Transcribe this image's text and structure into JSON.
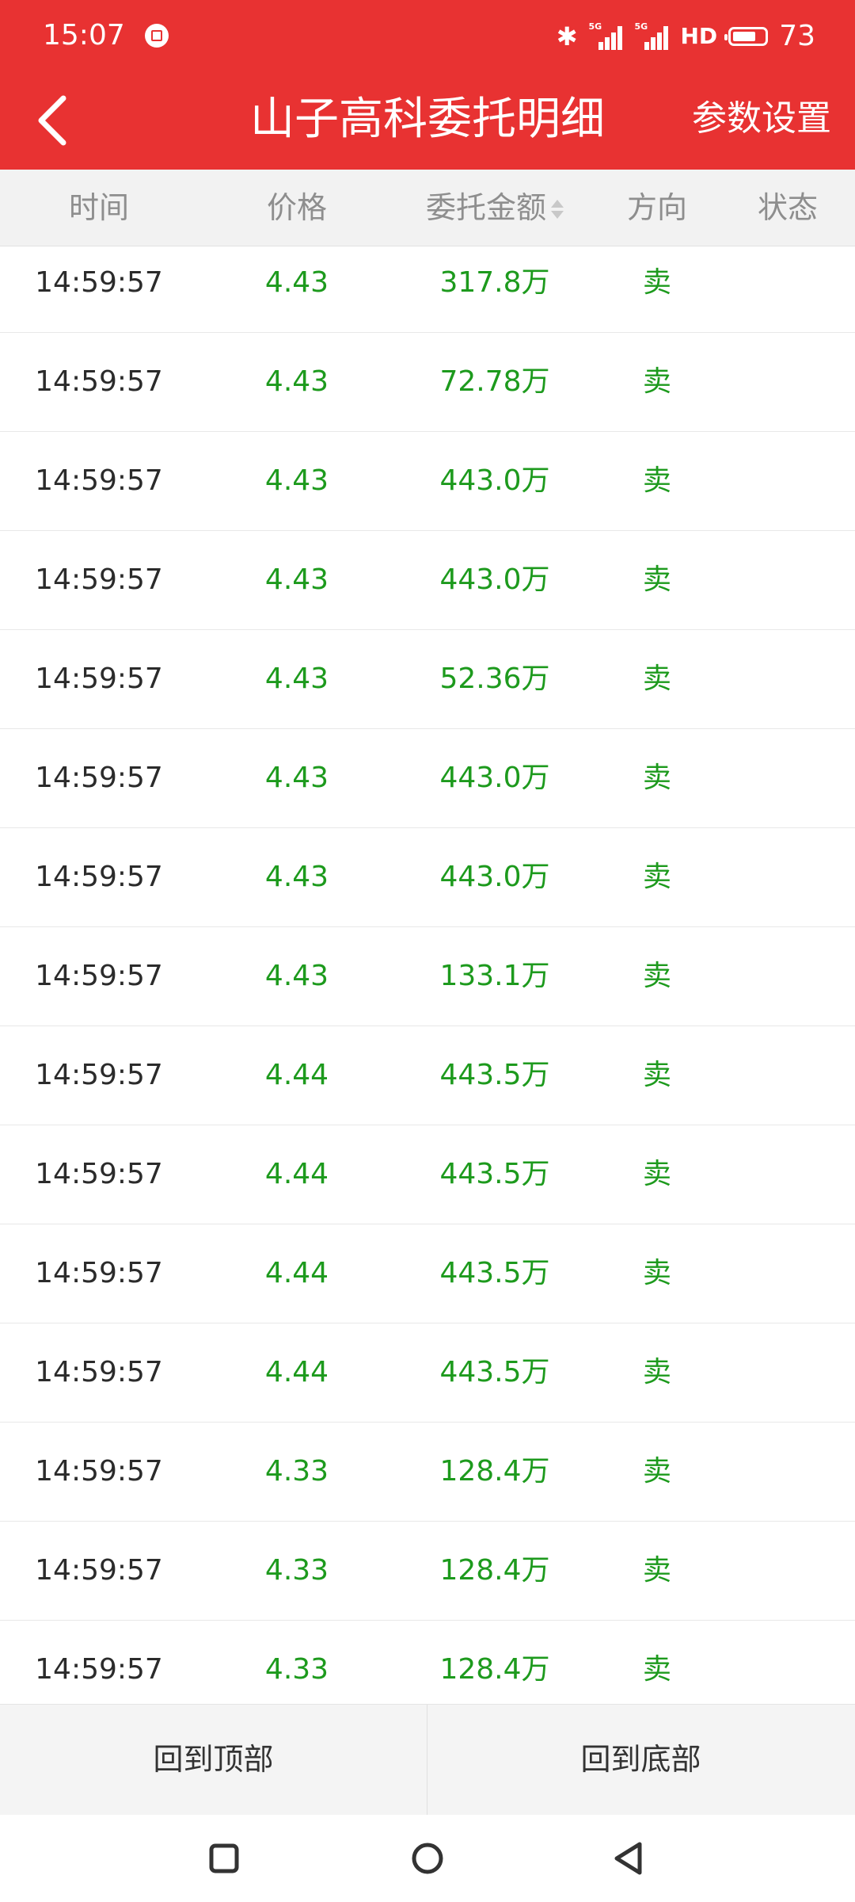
{
  "status_bar": {
    "time": "15:07",
    "signal_1_label": "5G",
    "signal_2_label": "5G",
    "hd_label": "HD",
    "battery_level": "73",
    "battery_fraction": 0.73,
    "icons": [
      "app-notification-icon",
      "bluetooth-icon",
      "signal-icon",
      "signal-icon",
      "battery-icon"
    ]
  },
  "header": {
    "title": "山子高科委托明细",
    "settings_label": "参数设置",
    "background_color": "#e83232"
  },
  "table": {
    "columns": [
      "时间",
      "价格",
      "委托金额",
      "方向",
      "状态"
    ],
    "sortable_column": "委托金额",
    "value_color": "#1d9a1d",
    "rows": [
      {
        "time": "14:59:57",
        "price": "4.43",
        "amount": "317.8万",
        "direction": "卖",
        "status": ""
      },
      {
        "time": "14:59:57",
        "price": "4.43",
        "amount": "72.78万",
        "direction": "卖",
        "status": ""
      },
      {
        "time": "14:59:57",
        "price": "4.43",
        "amount": "443.0万",
        "direction": "卖",
        "status": ""
      },
      {
        "time": "14:59:57",
        "price": "4.43",
        "amount": "443.0万",
        "direction": "卖",
        "status": ""
      },
      {
        "time": "14:59:57",
        "price": "4.43",
        "amount": "52.36万",
        "direction": "卖",
        "status": ""
      },
      {
        "time": "14:59:57",
        "price": "4.43",
        "amount": "443.0万",
        "direction": "卖",
        "status": ""
      },
      {
        "time": "14:59:57",
        "price": "4.43",
        "amount": "443.0万",
        "direction": "卖",
        "status": ""
      },
      {
        "time": "14:59:57",
        "price": "4.43",
        "amount": "133.1万",
        "direction": "卖",
        "status": ""
      },
      {
        "time": "14:59:57",
        "price": "4.44",
        "amount": "443.5万",
        "direction": "卖",
        "status": ""
      },
      {
        "time": "14:59:57",
        "price": "4.44",
        "amount": "443.5万",
        "direction": "卖",
        "status": ""
      },
      {
        "time": "14:59:57",
        "price": "4.44",
        "amount": "443.5万",
        "direction": "卖",
        "status": ""
      },
      {
        "time": "14:59:57",
        "price": "4.44",
        "amount": "443.5万",
        "direction": "卖",
        "status": ""
      },
      {
        "time": "14:59:57",
        "price": "4.33",
        "amount": "128.4万",
        "direction": "卖",
        "status": ""
      },
      {
        "time": "14:59:57",
        "price": "4.33",
        "amount": "128.4万",
        "direction": "卖",
        "status": ""
      },
      {
        "time": "14:59:57",
        "price": "4.33",
        "amount": "128.4万",
        "direction": "卖",
        "status": ""
      }
    ]
  },
  "bottom_buttons": {
    "to_top": "回到顶部",
    "to_bottom": "回到底部"
  },
  "nav_bar": {
    "icons": [
      "recent-apps-icon",
      "home-icon",
      "back-icon"
    ]
  }
}
